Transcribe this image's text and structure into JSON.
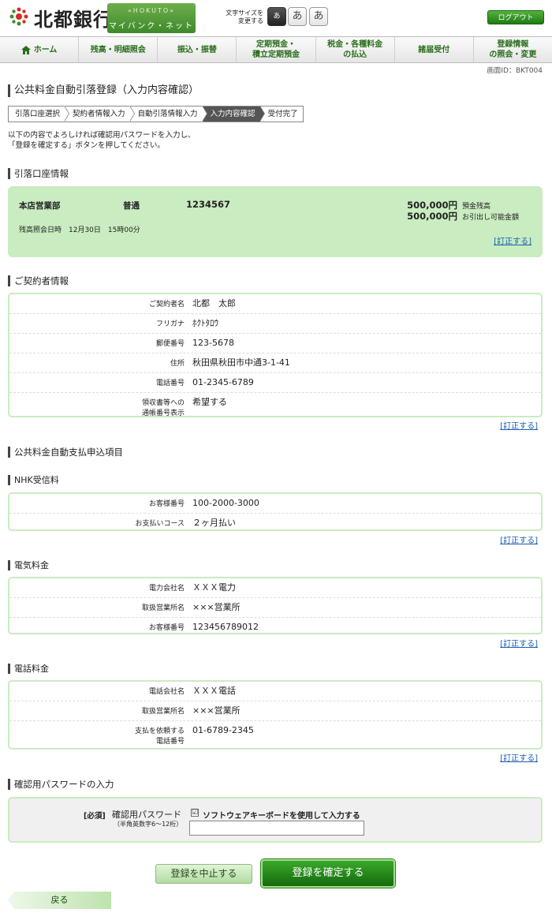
{
  "brand": {
    "name": "北都銀行",
    "sub_en": "«HOKUTO»",
    "sub_jp": "マイバンク・ネット"
  },
  "font_size": {
    "label_line1": "文字サイズを",
    "label_line2": "変更する",
    "options": [
      "あ",
      "あ",
      "あ"
    ]
  },
  "logout_label": "ログアウト",
  "nav": [
    {
      "label": "ホーム",
      "label2": ""
    },
    {
      "label": "残高・明細照会",
      "label2": ""
    },
    {
      "label": "振込・振替",
      "label2": ""
    },
    {
      "label": "定期預金・",
      "label2": "積立定期預金"
    },
    {
      "label": "税金・各種料金",
      "label2": "の払込"
    },
    {
      "label": "諸届受付",
      "label2": ""
    },
    {
      "label": "登録情報",
      "label2": "の照会・変更"
    }
  ],
  "screen_id": "画面ID：BKT004",
  "title": "公共料金自動引落登録（入力内容確認）",
  "steps": [
    "引落口座選択",
    "契約者情報入力",
    "自動引落情報入力",
    "入力内容確認",
    "受付完了"
  ],
  "instruction": {
    "line1": "以下の内容でよろしければ確認用パスワードを入力し、",
    "line2": "「登録を確定する」ボタンを押してください。"
  },
  "account_section": {
    "title": "引落口座情報",
    "branch": "本店営業部",
    "type": "普通",
    "number": "1234567",
    "balance": "500,000円",
    "balance_label": "預金残高",
    "withdrawable": "500,000円",
    "withdrawable_label": "お引出し可能金額",
    "time": "残高照会日時　12月30日　15時00分",
    "fix": "[訂正する]"
  },
  "contractor_section": {
    "title": "ご契約者情報",
    "rows": [
      {
        "label": "ご契約者名",
        "label2": "",
        "value": "北都　太郎"
      },
      {
        "label": "フリガナ",
        "label2": "",
        "value": "ﾎｸﾄﾀﾛｳ"
      },
      {
        "label": "郵便番号",
        "label2": "",
        "value": "123-5678"
      },
      {
        "label": "住所",
        "label2": "",
        "value": "秋田県秋田市中通3-1-41"
      },
      {
        "label": "電話番号",
        "label2": "",
        "value": "01-2345-6789"
      },
      {
        "label": "領収書等への",
        "label2": "通帳番号表示",
        "value": "希望する"
      }
    ],
    "fix": "[訂正する]"
  },
  "payment_section": {
    "title": "公共料金自動支払申込項目"
  },
  "nhk": {
    "title": "NHK受信料",
    "rows": [
      {
        "label": "お客様番号",
        "label2": "",
        "value": "100-2000-3000"
      },
      {
        "label": "お支払いコース",
        "label2": "",
        "value": "２ヶ月払い"
      }
    ],
    "fix": "[訂正する]"
  },
  "electric": {
    "title": "電気料金",
    "rows": [
      {
        "label": "電力会社名",
        "label2": "",
        "value": "ＸＸＸ電力"
      },
      {
        "label": "取扱営業所名",
        "label2": "",
        "value": "×××営業所"
      },
      {
        "label": "お客様番号",
        "label2": "",
        "value": "123456789012"
      }
    ],
    "fix": "[訂正する]"
  },
  "phone": {
    "title": "電話料金",
    "rows": [
      {
        "label": "電話会社名",
        "label2": "",
        "value": "ＸＸＸ電話"
      },
      {
        "label": "取扱営業所名",
        "label2": "",
        "value": "×××営業所"
      },
      {
        "label": "支払を依頼する",
        "label2": "電話番号",
        "value": "01-6789-2345"
      }
    ],
    "fix": "[訂正する]"
  },
  "password_section": {
    "title": "確認用パスワードの入力",
    "required": "[必須]",
    "label": "確認用パスワード",
    "note": "（半角英数字6～12桁）",
    "checkbox_mark": "☑",
    "checkbox_label": "ソフトウェアキーボードを使用して入力する",
    "input_value": ""
  },
  "buttons": {
    "cancel": "登録を中止する",
    "confirm": "登録を確定する",
    "back": "戻る"
  },
  "colors": {
    "accent_green": "#1f7a14",
    "panel_green": "#c9ecc0",
    "link_blue": "#1a5fb4"
  }
}
